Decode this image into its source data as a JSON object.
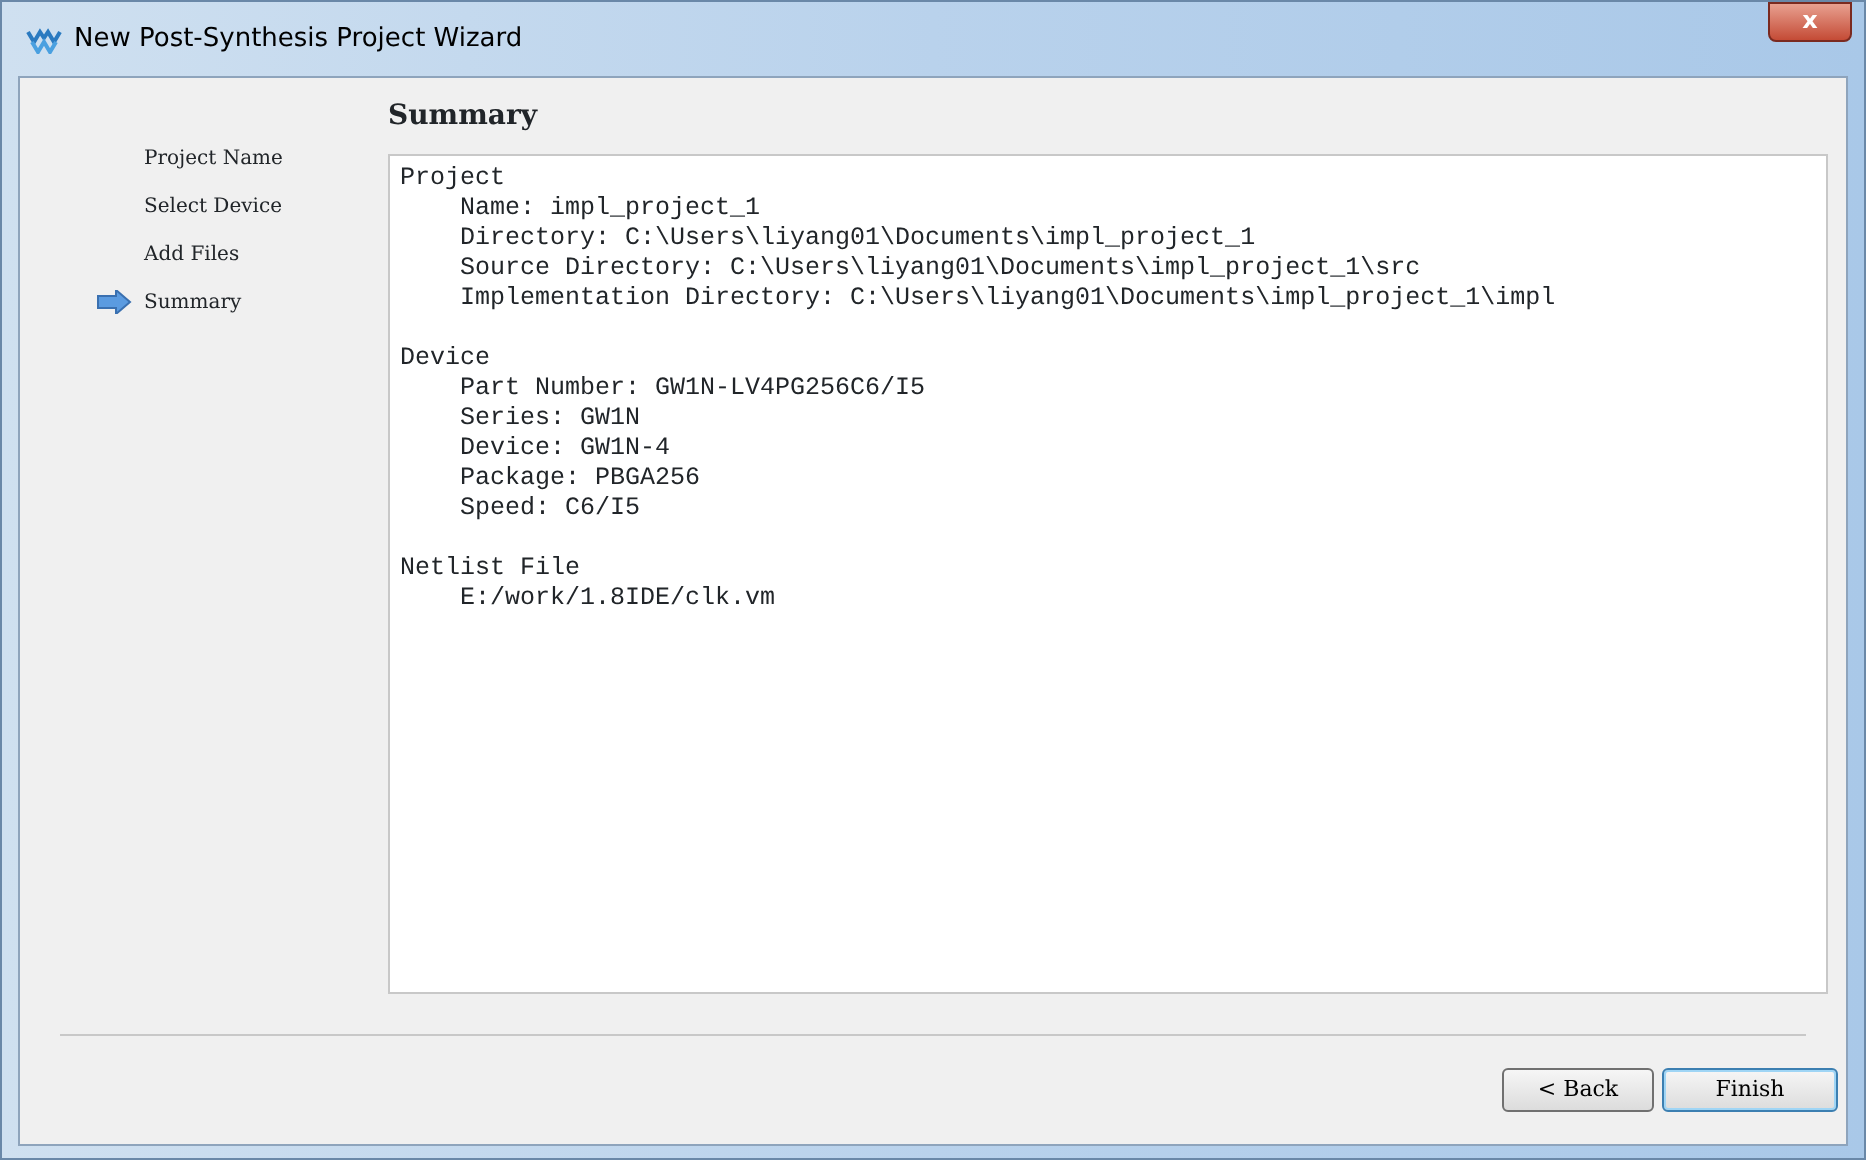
{
  "window": {
    "title": "New Post-Synthesis Project Wizard",
    "close": "x"
  },
  "steps": [
    {
      "label": "Project Name",
      "selected": false
    },
    {
      "label": "Select Device",
      "selected": false
    },
    {
      "label": "Add Files",
      "selected": false
    },
    {
      "label": "Summary",
      "selected": true
    }
  ],
  "page_title": "Summary",
  "summary": [
    {
      "heading": "Project",
      "lines": [
        "Name: impl_project_1",
        "Directory: C:\\Users\\liyang01\\Documents\\impl_project_1",
        "Source Directory: C:\\Users\\liyang01\\Documents\\impl_project_1\\src",
        "Implementation Directory: C:\\Users\\liyang01\\Documents\\impl_project_1\\impl"
      ]
    },
    {
      "heading": "Device",
      "lines": [
        "Part Number: GW1N-LV4PG256C6/I5",
        "Series: GW1N",
        "Device: GW1N-4",
        "Package: PBGA256",
        "Speed: C6/I5"
      ]
    },
    {
      "heading": "Netlist File",
      "lines": [
        "E:/work/1.8IDE/clk.vm"
      ]
    }
  ],
  "buttons": [
    {
      "label": "< Back",
      "default": false
    },
    {
      "label": "Finish",
      "default": true
    }
  ]
}
